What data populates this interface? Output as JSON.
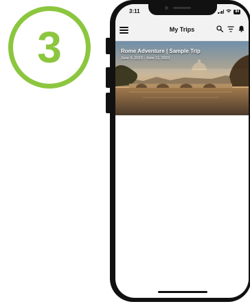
{
  "step": {
    "number": "3"
  },
  "status_bar": {
    "time": "3:11",
    "battery": "84"
  },
  "header": {
    "title": "My Trips"
  },
  "trips": [
    {
      "title": "Rome Adventure | Sample Trip",
      "dates": "June 5, 2023 - June 11, 2023"
    }
  ],
  "colors": {
    "accent": "#8cc63f"
  },
  "icons": [
    "menu-icon",
    "search-icon",
    "filter-icon",
    "bell-icon",
    "wifi-icon",
    "signal-icon",
    "battery-icon"
  ]
}
